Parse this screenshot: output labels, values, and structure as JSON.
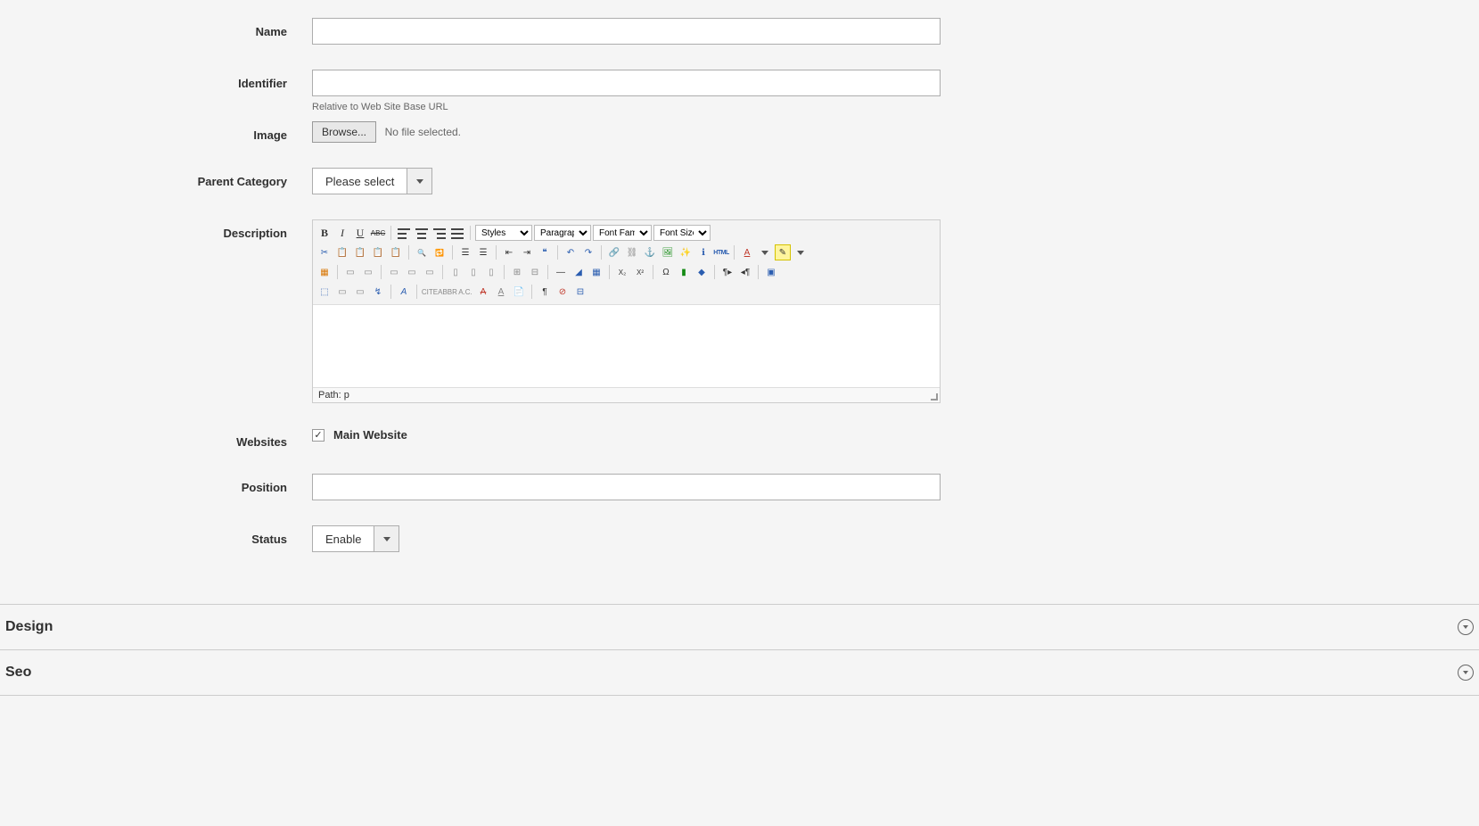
{
  "fields": {
    "name": {
      "label": "Name",
      "value": ""
    },
    "identifier": {
      "label": "Identifier",
      "value": "",
      "help": "Relative to Web Site Base URL"
    },
    "image": {
      "label": "Image",
      "browse": "Browse...",
      "no_file": "No file selected."
    },
    "parent": {
      "label": "Parent Category",
      "value": "Please select"
    },
    "description": {
      "label": "Description"
    },
    "websites": {
      "label": "Websites",
      "option": "Main Website",
      "checked": true
    },
    "position": {
      "label": "Position",
      "value": ""
    },
    "status": {
      "label": "Status",
      "value": "Enable"
    }
  },
  "editor": {
    "styles": "Styles",
    "format": "Paragraph",
    "font_family": "Font Family",
    "font_size": "Font Size",
    "path": "Path: p"
  },
  "sections": {
    "design": "Design",
    "seo": "Seo"
  }
}
